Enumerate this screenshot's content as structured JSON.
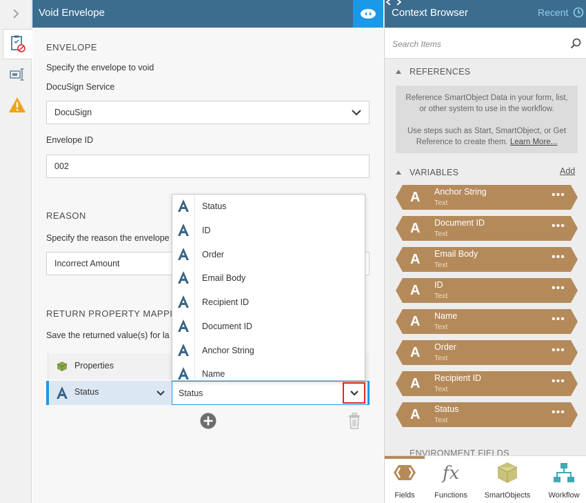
{
  "center": {
    "title": "Void Envelope",
    "envelope": {
      "heading": "ENVELOPE",
      "description": "Specify the envelope to void",
      "service_label": "DocuSign Service",
      "service_value": "DocuSign",
      "envelope_id_label": "Envelope ID",
      "envelope_id_value": "002"
    },
    "reason": {
      "heading": "REASON",
      "description": "Specify the reason the envelope",
      "value": "Incorrect Amount"
    },
    "return_mapping": {
      "heading": "RETURN PROPERTY MAPPIN",
      "description": "Save the returned value(s) for la",
      "properties_label": "Properties",
      "status_label": "Status",
      "status_value": "Status"
    },
    "dropdown_items": [
      "Status",
      "ID",
      "Order",
      "Email Body",
      "Recipient ID",
      "Document ID",
      "Anchor String",
      "Name"
    ]
  },
  "context_browser": {
    "title": "Context Browser",
    "recent": "Recent",
    "search_placeholder": "Search Items",
    "references_heading": "REFERENCES",
    "references_text_1": "Reference SmartObject Data in your form, list, or other system to use in the workflow.",
    "references_text_2": "Use steps such as Start, SmartObject, or Get Reference to create them.",
    "learn_more": "Learn More...",
    "variables_heading": "VARIABLES",
    "add": "Add",
    "variables": [
      {
        "name": "Anchor String",
        "type": "Text"
      },
      {
        "name": "Document ID",
        "type": "Text"
      },
      {
        "name": "Email Body",
        "type": "Text"
      },
      {
        "name": "ID",
        "type": "Text"
      },
      {
        "name": "Name",
        "type": "Text"
      },
      {
        "name": "Order",
        "type": "Text"
      },
      {
        "name": "Recipient ID",
        "type": "Text"
      },
      {
        "name": "Status",
        "type": "Text"
      }
    ],
    "environment_heading": "ENVIRONMENT FIELDS",
    "bottom_tabs": [
      "Fields",
      "Functions",
      "SmartObjects",
      "Workflow"
    ]
  },
  "colors": {
    "header": "#3c6d8f",
    "accent_blue": "#1a9ae6",
    "variable_brown": "#b58a5a",
    "highlight_red": "#e0262b",
    "letter_icon": "#3a6585"
  }
}
